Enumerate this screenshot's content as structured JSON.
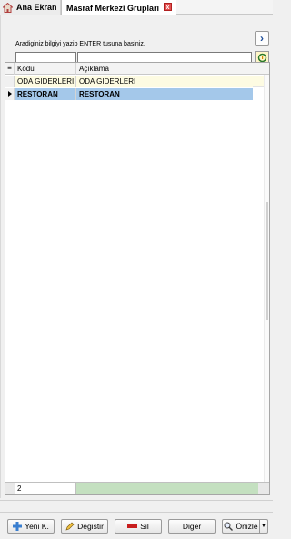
{
  "tabs": [
    {
      "label": "Ana Ekran"
    },
    {
      "label": "Masraf Merkezi Grupları"
    }
  ],
  "search": {
    "hint": "Aradiginiz bilgiyi yazip ENTER tusuna basiniz.",
    "value1": "",
    "value2": ""
  },
  "grid": {
    "columns": [
      "Kodu",
      "Açıklama"
    ],
    "rows": [
      {
        "code": "ODA GIDERLERI",
        "desc": "ODA GIDERLERI"
      },
      {
        "code": "RESTORAN",
        "desc": "RESTORAN"
      }
    ],
    "footer_count": "2"
  },
  "buttons": {
    "new": "Yeni K.",
    "edit": "Degistir",
    "delete": "Sil",
    "other": "Diger",
    "preview": "Önizle"
  },
  "colors": {
    "selected_row": "#a4c8ea",
    "first_row": "#fdfbe2",
    "footer_sum": "#c4e0c0"
  }
}
